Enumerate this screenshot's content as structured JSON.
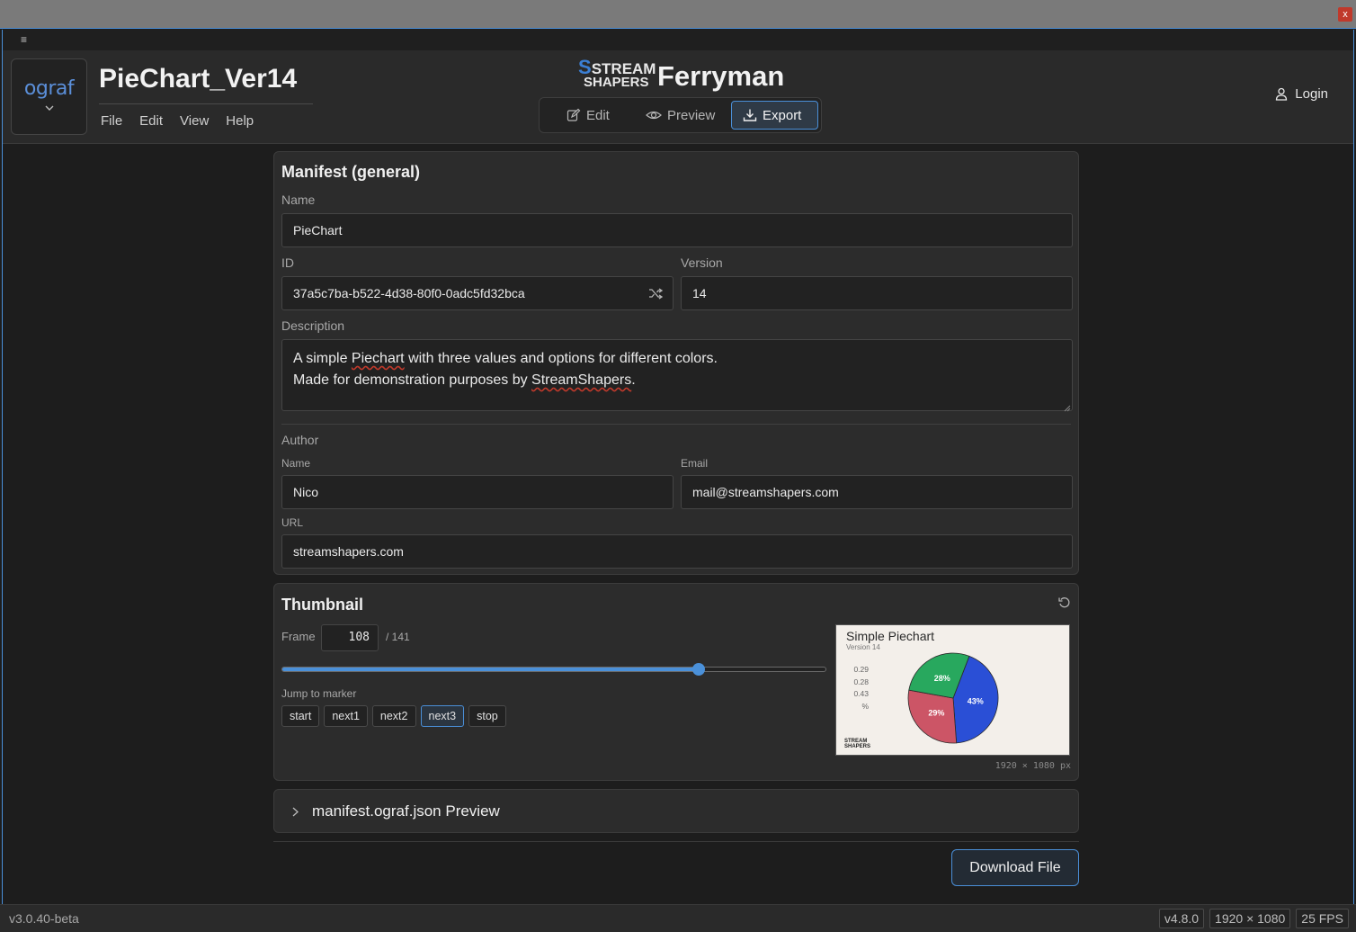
{
  "window": {
    "close_glyph": "x"
  },
  "menu_strip": {
    "hamburger": "≡"
  },
  "header": {
    "logo_text": "ograf",
    "doc_title": "PieChart_Ver14",
    "menus": [
      "File",
      "Edit",
      "View",
      "Help"
    ],
    "brand_logo_line1": "STREAM",
    "brand_logo_line2": "SHAPERS",
    "brand_name": "Ferryman",
    "modes": [
      {
        "label": "Edit",
        "icon": "pencil-icon",
        "active": false
      },
      {
        "label": "Preview",
        "icon": "eye-icon",
        "active": false
      },
      {
        "label": "Export",
        "icon": "download-icon",
        "active": true
      }
    ],
    "login_label": "Login"
  },
  "manifest": {
    "title": "Manifest (general)",
    "name_label": "Name",
    "name_value": "PieChart",
    "id_label": "ID",
    "id_value": "37a5c7ba-b522-4d38-80f0-0adc5fd32bca",
    "version_label": "Version",
    "version_value": "14",
    "description_label": "Description",
    "description_line1_pre": "A simple ",
    "description_line1_err": "Piechart",
    "description_line1_post": " with three values and options for different colors.",
    "description_line2_pre": "Made for demonstration purposes by ",
    "description_line2_err": "StreamShapers",
    "description_line2_post": ".",
    "author_label": "Author",
    "author_name_label": "Name",
    "author_name_value": "Nico",
    "author_email_label": "Email",
    "author_email_value": "mail@streamshapers.com",
    "url_label": "URL",
    "url_value": "streamshapers.com"
  },
  "thumbnail": {
    "title": "Thumbnail",
    "frame_label": "Frame",
    "frame_value": "108",
    "frame_total": "/ 141",
    "slider_fraction": 0.766,
    "jump_label": "Jump to marker",
    "markers": [
      {
        "label": "start",
        "active": false
      },
      {
        "label": "next1",
        "active": false
      },
      {
        "label": "next2",
        "active": false
      },
      {
        "label": "next3",
        "active": true
      },
      {
        "label": "stop",
        "active": false
      }
    ],
    "preview": {
      "title": "Simple Piechart",
      "subtitle": "Version 14",
      "legend_values": [
        "0.29",
        "0.28",
        "0.43",
        "%"
      ],
      "slices": [
        {
          "label": "43%",
          "value": 0.43,
          "color": "#2a4fd6"
        },
        {
          "label": "29%",
          "value": 0.29,
          "color": "#cc5566"
        },
        {
          "label": "28%",
          "value": 0.28,
          "color": "#28a85e"
        }
      ],
      "logo_text": "STREAM SHAPERS"
    },
    "resolution_caption": "1920 × 1080 px"
  },
  "manifest_preview": {
    "label": "manifest.ograf.json Preview"
  },
  "download_label": "Download File",
  "statusbar": {
    "version": "v3.0.40-beta",
    "stats": [
      "v4.8.0",
      "1920 × 1080",
      "25 FPS"
    ]
  },
  "colors": {
    "accent": "#4a8fd8",
    "background": "#1d1d1d",
    "panel": "#2c2c2c"
  }
}
